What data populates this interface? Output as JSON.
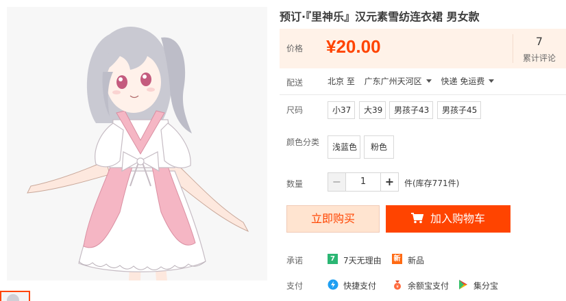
{
  "product": {
    "title": "预订·『里神乐』汉元素雪纺连衣裙 男女款",
    "image_alt": "anime-girl-pink-white-dress"
  },
  "price": {
    "label": "价格",
    "value": "¥20.00",
    "color": "#ff4400",
    "review_count": "7",
    "review_label": "累计评论"
  },
  "shipping": {
    "label": "配送",
    "from": "北京 至",
    "to": "广东广州天河区",
    "method": "快递 免运费"
  },
  "size": {
    "label": "尺码",
    "options": [
      "小37",
      "大39",
      "男孩子43",
      "男孩子45"
    ]
  },
  "color": {
    "label": "颜色分类",
    "options": [
      "浅蓝色",
      "粉色"
    ]
  },
  "quantity": {
    "label": "数量",
    "minus": "−",
    "value": "1",
    "plus": "+",
    "stock": "件(库存771件)"
  },
  "actions": {
    "buy_now": "立即购买",
    "add_to_cart": "加入购物车",
    "accent": "#ff4400"
  },
  "promise": {
    "label": "承诺",
    "items": [
      {
        "badge": "7",
        "text": "7天无理由",
        "color": "#2bb673"
      },
      {
        "badge": "新",
        "text": "新品",
        "color": "#ff6a13"
      }
    ]
  },
  "payment": {
    "label": "支付",
    "items": [
      {
        "icon": "quick-pay-icon",
        "text": "快捷支付"
      },
      {
        "icon": "yuebao-icon",
        "text": "余额宝支付"
      },
      {
        "icon": "jifenbao-icon",
        "text": "集分宝"
      }
    ]
  }
}
